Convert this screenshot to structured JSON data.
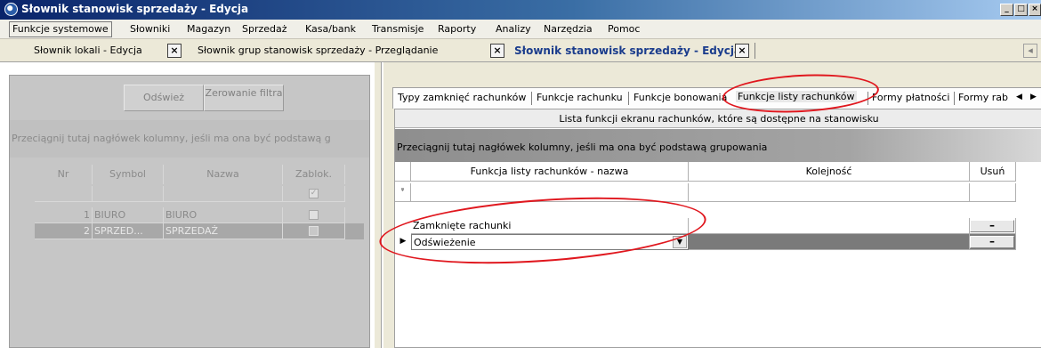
{
  "window": {
    "title": "Słownik stanowisk sprzedaży - Edycja",
    "controls": [
      "_",
      "□",
      "×"
    ]
  },
  "menu": [
    "Funkcje systemowe",
    "Słowniki",
    "Magazyn",
    "Sprzedaż",
    "Kasa/bank",
    "Transmisje",
    "Raporty",
    "Analizy",
    "Narzędzia",
    "Pomoc"
  ],
  "doc_tabs": [
    {
      "label": "Słownik lokali - Edycja",
      "close": "×"
    },
    {
      "label": "Słownik grup stanowisk sprzedaży - Przeglądanie",
      "close": "×"
    },
    {
      "label": "Słownik stanowisk sprzedaży - Edycja",
      "close": "×"
    }
  ],
  "left": {
    "refresh": "Odśwież",
    "reset_filter": "Zerowanie filtra",
    "group_hint": "Przeciągnij tutaj nagłówek kolumny, jeśli ma ona być podstawą g",
    "columns": [
      "Nr",
      "Symbol",
      "Nazwa",
      "Zablok."
    ],
    "rows": [
      {
        "nr": "1",
        "symbol": "BIURO",
        "nazwa": "BIURO",
        "blocked": false
      },
      {
        "nr": "2",
        "symbol": "SPRZED...",
        "nazwa": "SPRZEDAŻ",
        "blocked": false
      }
    ]
  },
  "right": {
    "tabs": [
      "Typy zamknięć rachunków",
      "Funkcje rachunku",
      "Funkcje bonowania",
      "Funkcje listy rachunków",
      "Formy płatności",
      "Formy rab"
    ],
    "active_tab": "Funkcje listy rachunków",
    "caption": "Lista funkcji ekranu rachunków, które są dostępne na stanowisku",
    "group_hint": "Przeciągnij tutaj nagłówek kolumny, jeśli ma ona być podstawą grupowania",
    "columns": [
      "Funkcja listy rachunków - nazwa",
      "Kolejność",
      "Usuń"
    ],
    "rows": [
      {
        "name": "Zamknięte rachunki",
        "order": "",
        "delete": "–"
      },
      {
        "name": "Odświeżenie",
        "order": "",
        "delete": "–"
      }
    ]
  },
  "colors": {
    "annotation": "#e0171e",
    "title_bar": "#0a246a",
    "active_doc_tab": "#1a3c8c"
  }
}
